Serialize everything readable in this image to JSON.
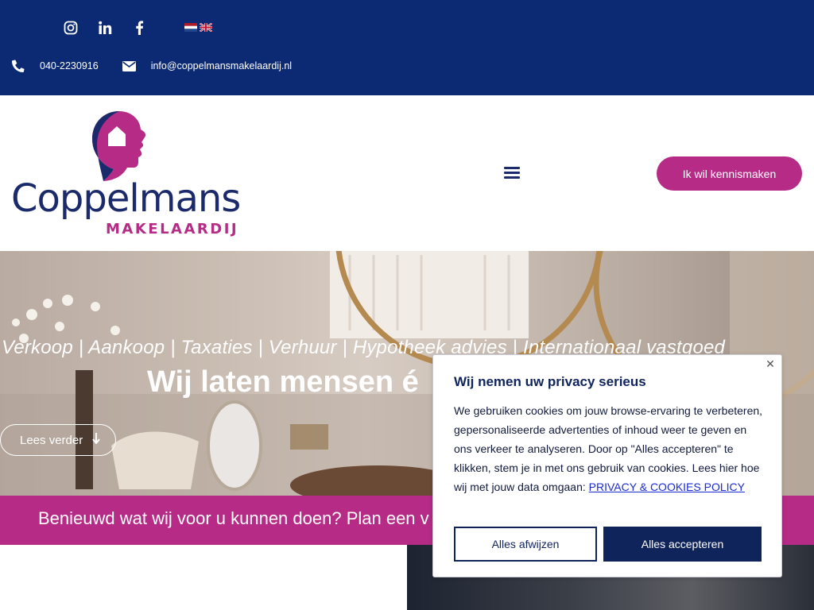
{
  "topbar": {
    "social": [
      {
        "icon": "instagram-icon"
      },
      {
        "icon": "linkedin-icon"
      },
      {
        "icon": "facebook-icon"
      }
    ],
    "languages": [
      {
        "icon": "dutch-flag-icon"
      },
      {
        "icon": "english-flag-icon"
      }
    ],
    "phone": "040-2230916",
    "email": "info@coppelmansmakelaardij.nl"
  },
  "header": {
    "logo_name": "Coppelmans",
    "logo_sub": "MAKELAARDIJ",
    "cta_label": "Ik wil kennismaken"
  },
  "hero": {
    "services": "Verkoop | Aankoop | Taxaties | Verhuur | Hypotheek advies | Internationaal vastgoed",
    "title": "Wij laten mensen é",
    "read_more": "Lees verder"
  },
  "banner": {
    "text": "Benieuwd wat wij voor u kunnen doen? Plan een v"
  },
  "cookie": {
    "title": "Wij nemen uw privacy serieus",
    "body": "We gebruiken cookies om jouw browse-ervaring te verbeteren, gepersonaliseerde advertenties of inhoud weer te geven en ons verkeer te analyseren. Door op \"Alles accepteren\" te klikken, stem je in met ons gebruik van cookies. Lees hier hoe wij met jouw data omgaan:",
    "link": "PRIVACY & COOKIES POLICY",
    "reject": "Alles afwijzen",
    "accept": "Alles accepteren"
  },
  "colors": {
    "navy": "#0b2a73",
    "magenta": "#b52b86",
    "dialog_navy": "#10245c"
  }
}
